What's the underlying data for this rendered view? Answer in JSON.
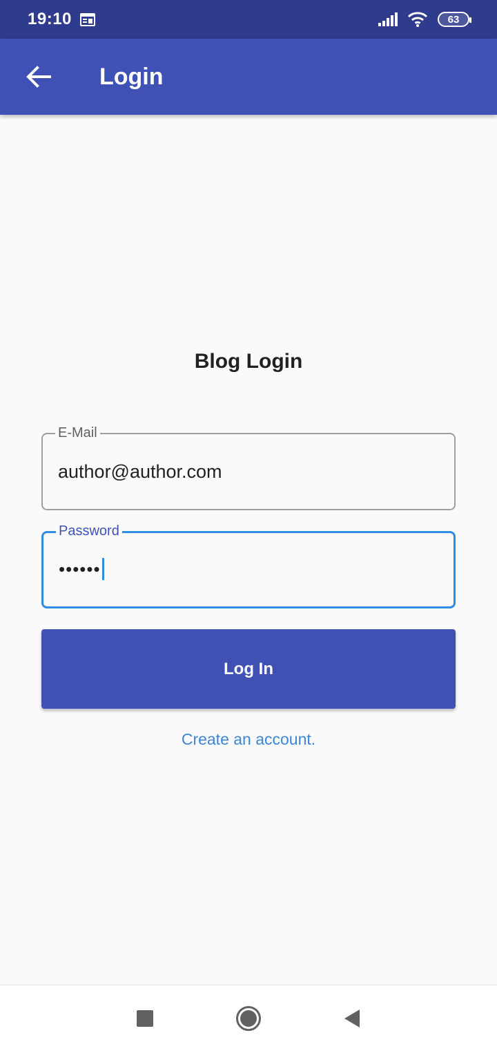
{
  "status_bar": {
    "time": "19:10",
    "calendar_icon": "calendar-icon",
    "signal_icon": "cellular-signal-icon",
    "wifi_icon": "wifi-icon",
    "battery_level": "63"
  },
  "app_bar": {
    "back_icon": "arrow-back-icon",
    "title": "Login"
  },
  "form": {
    "heading": "Blog Login",
    "email": {
      "label": "E-Mail",
      "value": "author@author.com"
    },
    "password": {
      "label": "Password",
      "value": "••••••"
    },
    "login_button": "Log In",
    "create_account_link": "Create an account."
  },
  "nav_bar": {
    "recents_icon": "square-recents-icon",
    "home_icon": "circle-home-icon",
    "back_icon": "triangle-back-icon"
  },
  "colors": {
    "status_bar": "#2f3b8c",
    "primary": "#3f51b5",
    "focus_border": "#2e8fe0",
    "link": "#3d86d6",
    "background": "#fafafa"
  }
}
